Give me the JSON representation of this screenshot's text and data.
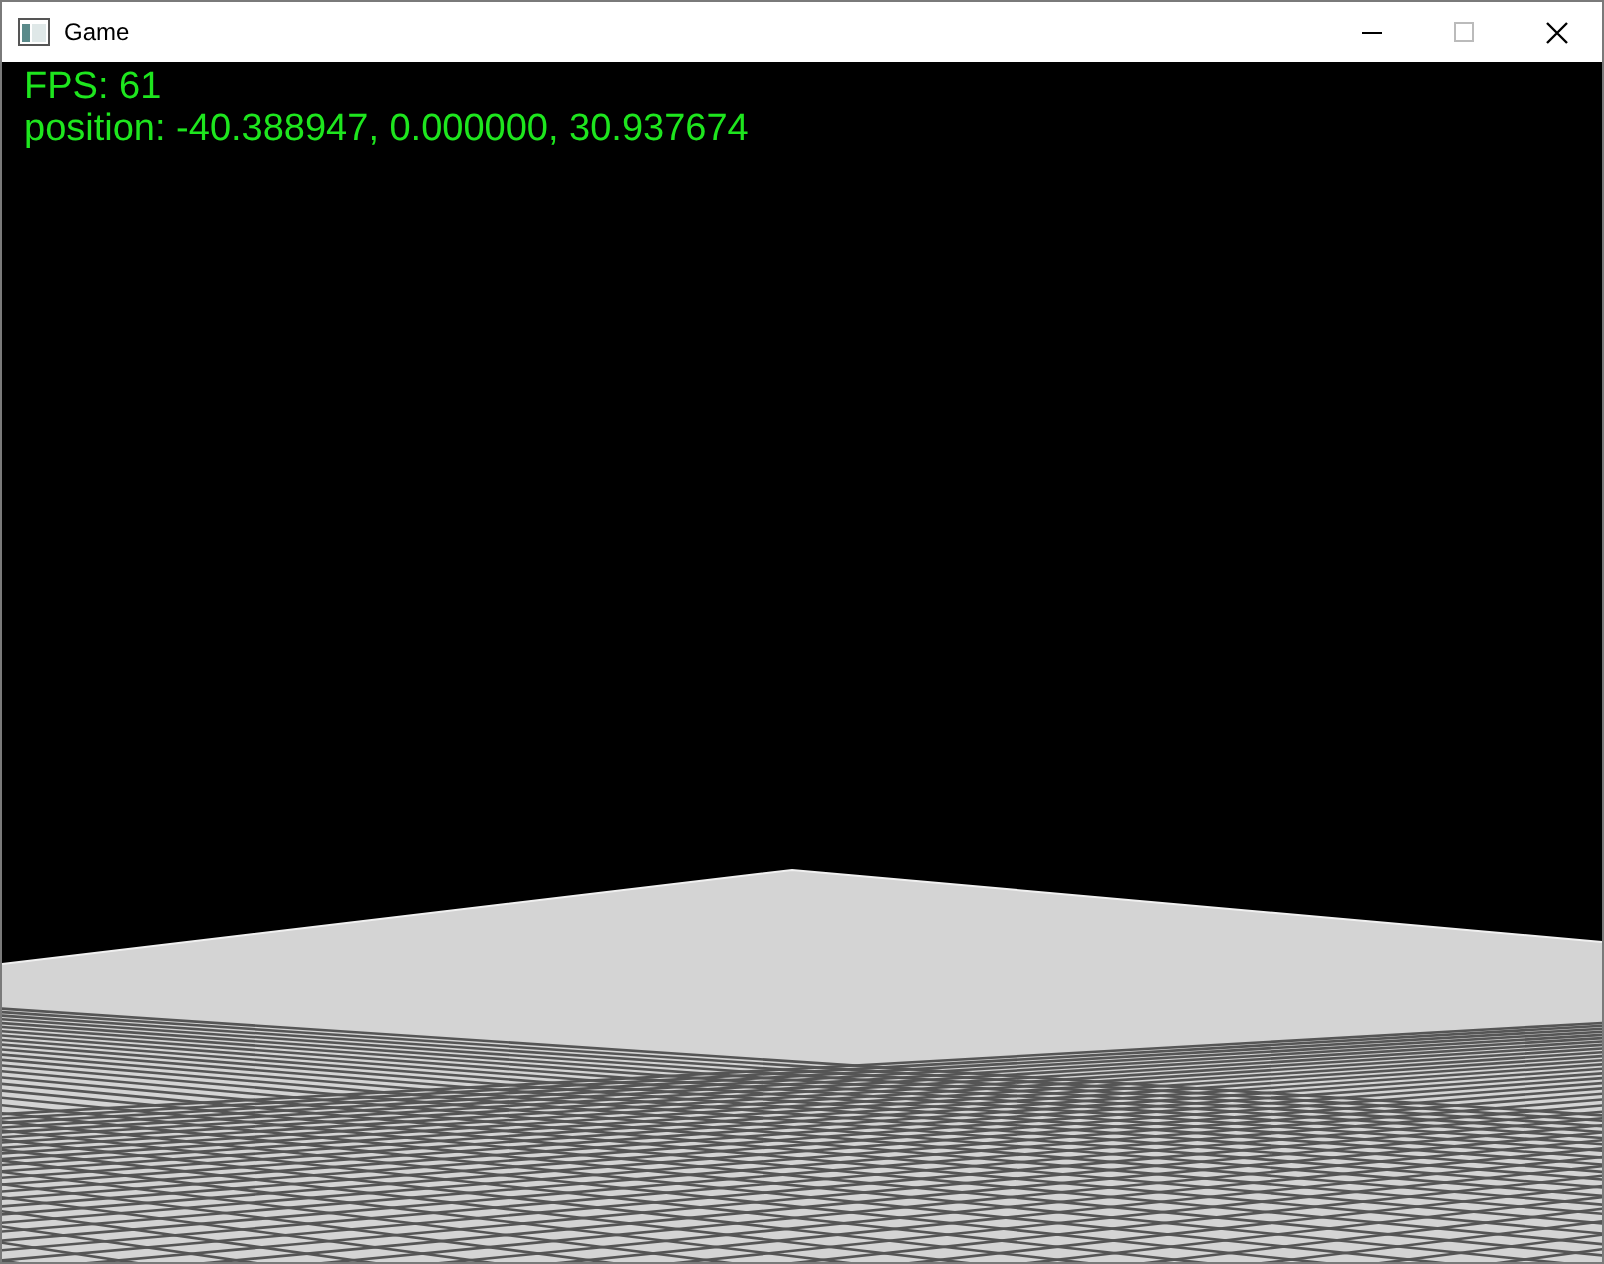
{
  "window": {
    "title": "Game"
  },
  "overlay": {
    "lines": [
      "FPS: 61",
      "position: -40.388947, 0.000000, 30.937674"
    ]
  }
}
